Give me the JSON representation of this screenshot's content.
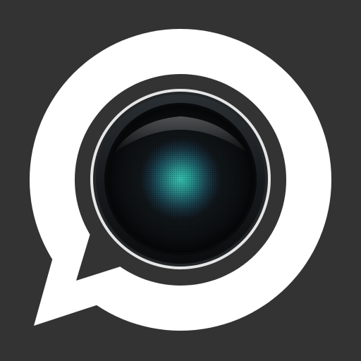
{
  "app_icon": {
    "icon_name": "chat-bubble-camera-lens-icon",
    "colors": {
      "background": "#333333",
      "bubble": "#ffffff",
      "bezel": "#333333",
      "lens_ring": "#e8e8e8",
      "lens_body": "#0d1012",
      "lens_glow": "#2fb3a6"
    }
  }
}
